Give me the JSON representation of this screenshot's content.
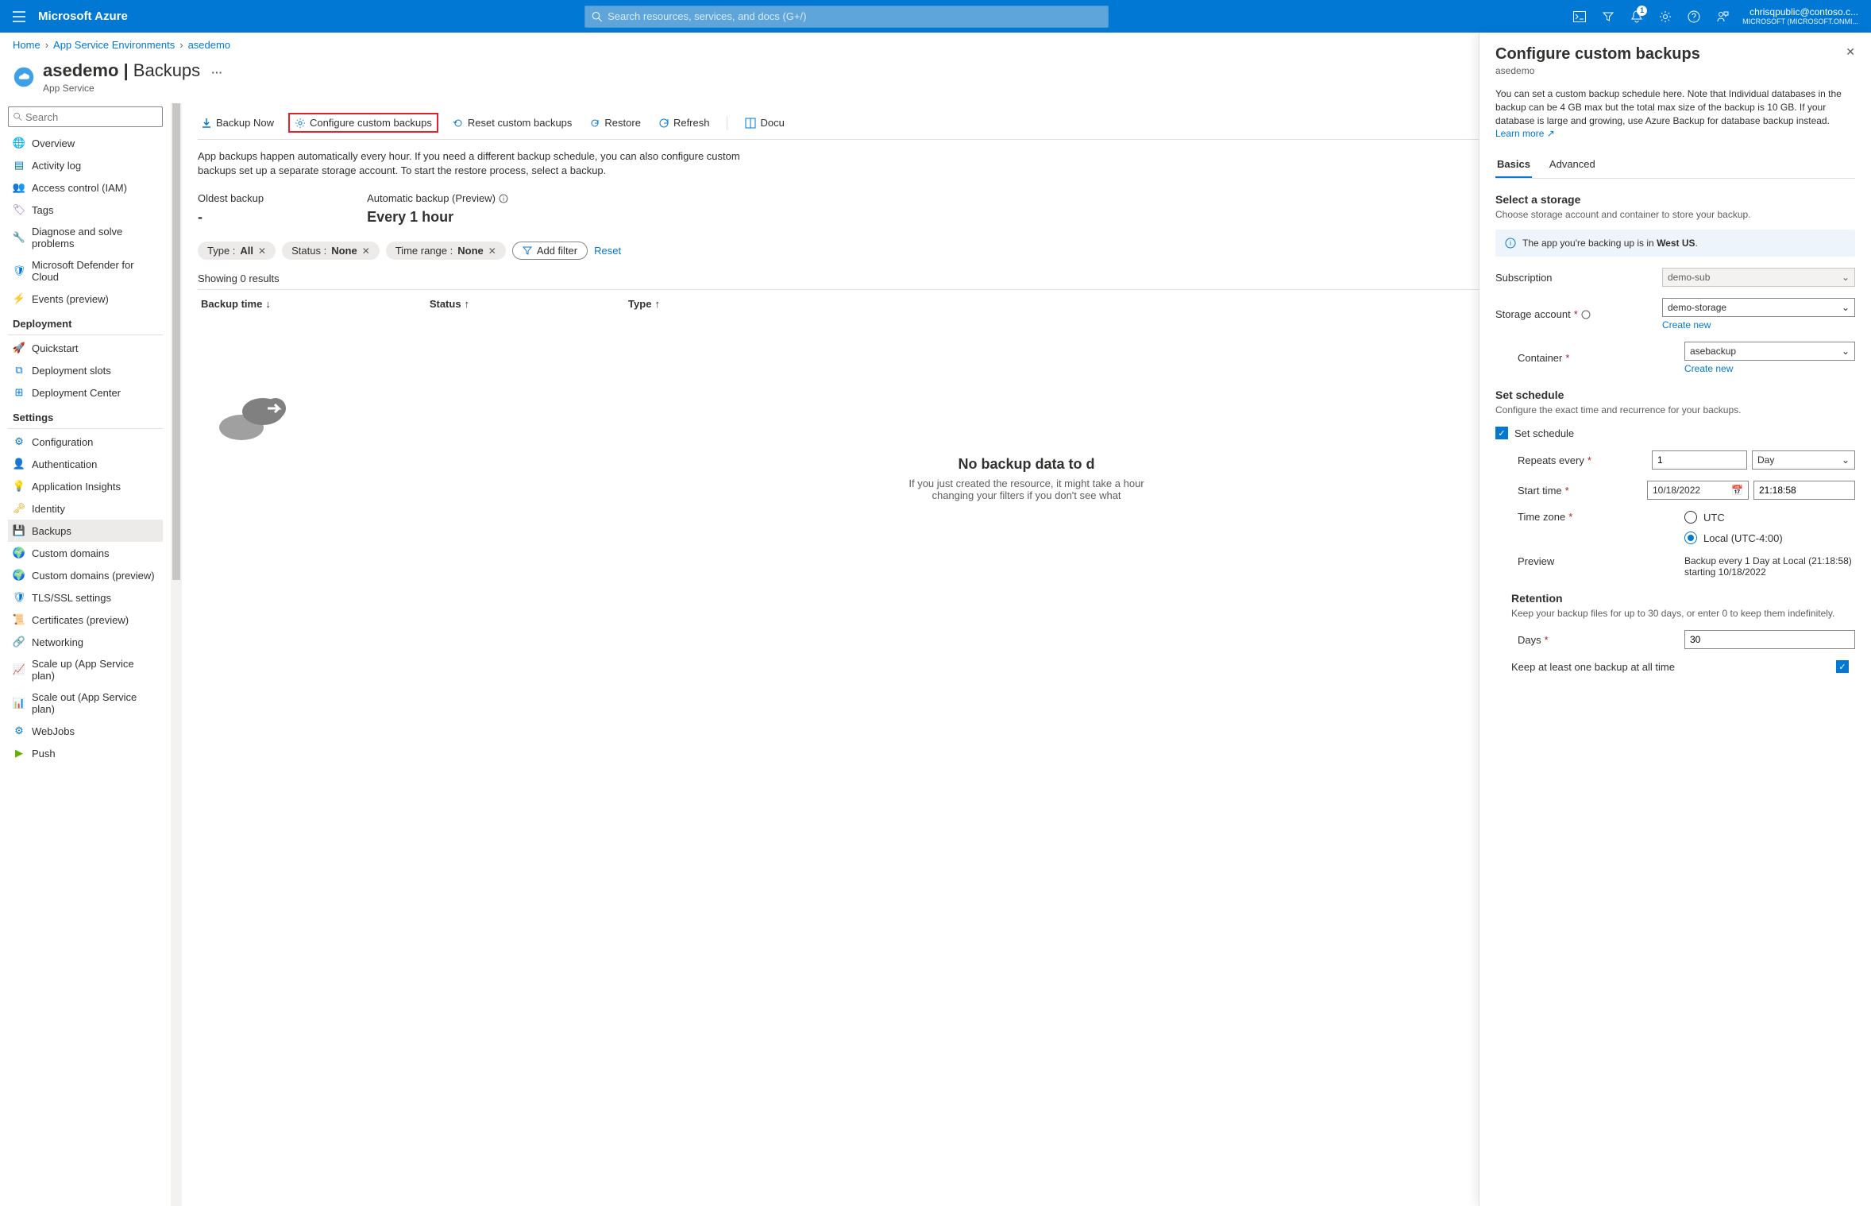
{
  "topbar": {
    "brand": "Microsoft Azure",
    "search_placeholder": "Search resources, services, and docs (G+/)",
    "notification_badge": "1",
    "account_email": "chrisqpublic@contoso.c...",
    "account_org": "MICROSOFT (MICROSOFT.ONMI..."
  },
  "breadcrumb": [
    "Home",
    "App Service Environments",
    "asedemo"
  ],
  "header": {
    "resource": "asedemo",
    "section": "Backups",
    "subtitle": "App Service",
    "more": "···"
  },
  "sidebar": {
    "search_placeholder": "Search",
    "groups": [
      {
        "title": null,
        "items": [
          "Overview",
          "Activity log",
          "Access control (IAM)",
          "Tags",
          "Diagnose and solve problems",
          "Microsoft Defender for Cloud",
          "Events (preview)"
        ]
      },
      {
        "title": "Deployment",
        "items": [
          "Quickstart",
          "Deployment slots",
          "Deployment Center"
        ]
      },
      {
        "title": "Settings",
        "items": [
          "Configuration",
          "Authentication",
          "Application Insights",
          "Identity",
          "Backups",
          "Custom domains",
          "Custom domains (preview)",
          "TLS/SSL settings",
          "Certificates (preview)",
          "Networking",
          "Scale up (App Service plan)",
          "Scale out (App Service plan)",
          "WebJobs",
          "Push"
        ]
      }
    ],
    "active": "Backups"
  },
  "commandbar": {
    "backup_now": "Backup Now",
    "configure": "Configure custom backups",
    "reset": "Reset custom backups",
    "restore": "Restore",
    "refresh": "Refresh",
    "docs": "Docu"
  },
  "intro": "App backups happen automatically every hour. If you need a different backup schedule, you can also configure custom backups set up a separate storage account. To start the restore process, select a backup.",
  "metrics": {
    "oldest_label": "Oldest backup",
    "oldest_value": "-",
    "auto_label": "Automatic backup (Preview)",
    "auto_value": "Every 1 hour"
  },
  "filters": {
    "type_label": "Type : ",
    "type_value": "All",
    "status_label": "Status : ",
    "status_value": "None",
    "timerange_label": "Time range : ",
    "timerange_value": "None",
    "add_filter": "Add filter",
    "reset": "Reset"
  },
  "results_text": "Showing 0 results",
  "table": {
    "col1": "Backup time",
    "col2": "Status",
    "col3": "Type"
  },
  "empty": {
    "title": "No backup data to d",
    "desc1": "If you just created the resource, it might take a hour",
    "desc2": "changing your filters if you don't see what"
  },
  "panel": {
    "title": "Configure custom backups",
    "sub": "asedemo",
    "desc": "You can set a custom backup schedule here. Note that Individual databases in the backup can be 4 GB max but the total max size of the backup is 10 GB. If your database is large and growing, use Azure Backup for database backup instead.",
    "learn_more": "Learn more",
    "tabs": {
      "basics": "Basics",
      "advanced": "Advanced"
    },
    "storage": {
      "heading": "Select a storage",
      "desc": "Choose storage account and container to store your backup.",
      "info_prefix": "The app you're backing up is in ",
      "info_region": "West US",
      "subscription_label": "Subscription",
      "subscription_value": "demo-sub",
      "account_label": "Storage account",
      "account_value": "demo-storage",
      "container_label": "Container",
      "container_value": "asebackup",
      "create_new": "Create new"
    },
    "schedule": {
      "heading": "Set schedule",
      "desc": "Configure the exact time and recurrence for your backups.",
      "checkbox_label": "Set schedule",
      "repeats_label": "Repeats every",
      "repeats_value": "1",
      "repeats_unit": "Day",
      "start_label": "Start time",
      "start_date": "10/18/2022",
      "start_time": "21:18:58",
      "tz_label": "Time zone",
      "tz_utc": "UTC",
      "tz_local": "Local (UTC-4:00)",
      "preview_label": "Preview",
      "preview_text": "Backup every 1 Day at Local (21:18:58) starting 10/18/2022"
    },
    "retention": {
      "heading": "Retention",
      "desc": "Keep your backup files for up to 30 days, or enter 0 to keep them indefinitely.",
      "days_label": "Days",
      "days_value": "30",
      "keep_label": "Keep at least one backup at all time"
    }
  }
}
